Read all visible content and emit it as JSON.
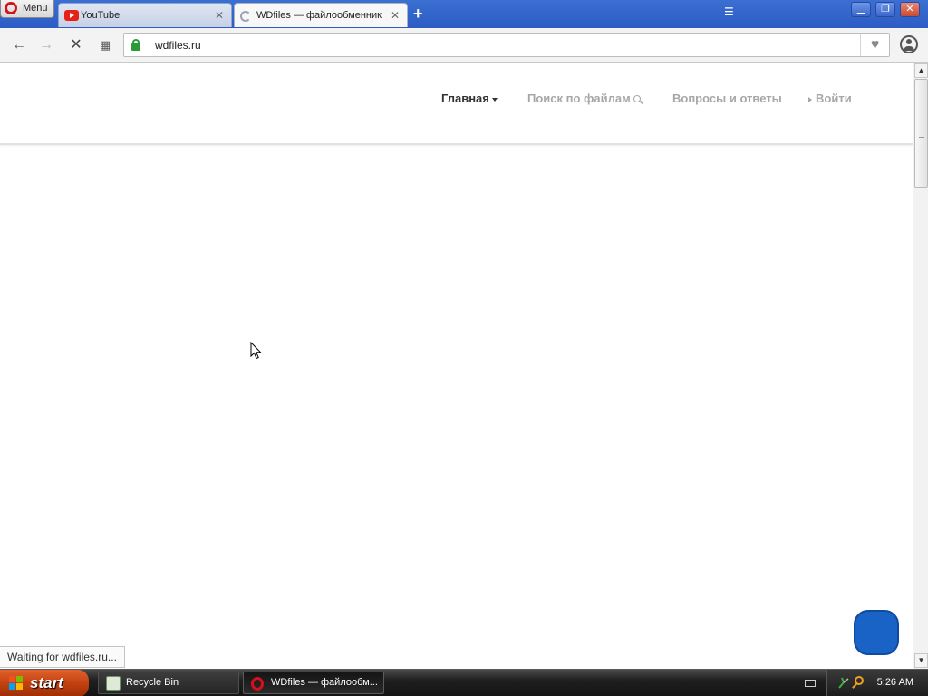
{
  "browser": {
    "menu_label": "Menu",
    "tabs": [
      {
        "title": "YouTube",
        "favicon": "youtube-icon",
        "active": false
      },
      {
        "title": "WDfiles — файлообменник б",
        "favicon": "loading-spinner-icon",
        "active": true
      }
    ],
    "address": {
      "url": "wdfiles.ru",
      "secure": true
    },
    "status_text": "Waiting for wdfiles.ru...",
    "colors": {
      "tabstrip": "#2c5cc4",
      "secure_lock": "#2d9a3a"
    }
  },
  "site": {
    "nav": [
      {
        "label": "Главная",
        "active": true
      },
      {
        "label": "Поиск по файлам",
        "active": false
      },
      {
        "label": "Вопросы и ответы",
        "active": false
      },
      {
        "label": "Войти",
        "active": false
      }
    ],
    "accent": "#1a63c6"
  },
  "taskbar": {
    "start_label": "start",
    "buttons": [
      {
        "label": "Recycle Bin",
        "active": false
      },
      {
        "label": "WDfiles — файлообм...",
        "active": true
      }
    ],
    "clock": "5:26 AM"
  }
}
